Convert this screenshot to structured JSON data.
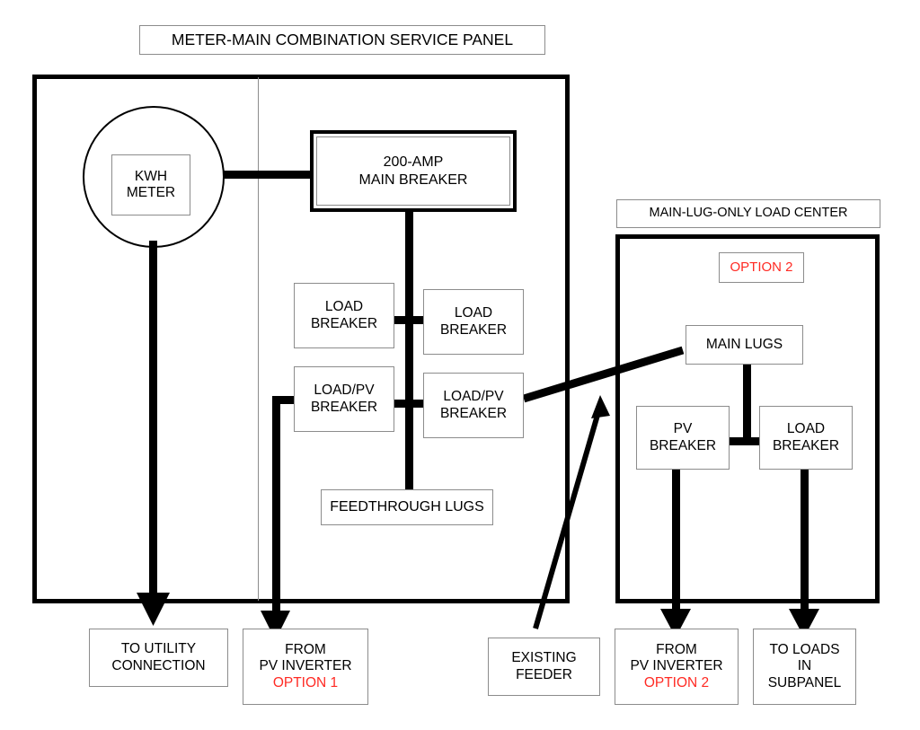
{
  "diagram": {
    "title_main_panel": "METER-MAIN COMBINATION SERVICE PANEL",
    "title_load_center": "MAIN-LUG-ONLY LOAD CENTER"
  },
  "main_panel": {
    "meter": {
      "line1": "KWH",
      "line2": "METER"
    },
    "main_breaker": {
      "line1": "200-AMP",
      "line2": "MAIN BREAKER"
    },
    "load_breaker_left": {
      "line1": "LOAD",
      "line2": "BREAKER"
    },
    "load_breaker_right": {
      "line1": "LOAD",
      "line2": "BREAKER"
    },
    "load_pv_breaker_left": {
      "line1": "LOAD/PV",
      "line2": "BREAKER"
    },
    "load_pv_breaker_right": {
      "line1": "LOAD/PV",
      "line2": "BREAKER"
    },
    "feedthrough_lugs": {
      "line1": "FEEDTHROUGH LUGS"
    }
  },
  "load_center": {
    "option_badge": "OPTION 2",
    "main_lugs": {
      "line1": "MAIN LUGS"
    },
    "pv_breaker": {
      "line1": "PV",
      "line2": "BREAKER"
    },
    "load_breaker": {
      "line1": "LOAD",
      "line2": "BREAKER"
    }
  },
  "terminals": {
    "to_utility": {
      "line1": "TO UTILITY",
      "line2": "CONNECTION"
    },
    "from_pv_inverter_opt1": {
      "line1": "FROM",
      "line2": "PV INVERTER",
      "line3": "OPTION 1"
    },
    "existing_feeder": {
      "line1": "EXISTING",
      "line2": "FEEDER"
    },
    "from_pv_inverter_opt2": {
      "line1": "FROM",
      "line2": "PV INVERTER",
      "line3": "OPTION 2"
    },
    "to_loads_subpanel": {
      "line1": "TO LOADS",
      "line2": "IN",
      "line3": "SUBPANEL"
    }
  },
  "colors": {
    "accent_red": "#ff2a23",
    "line_black": "#000000",
    "box_border": "#8c8c8c"
  }
}
